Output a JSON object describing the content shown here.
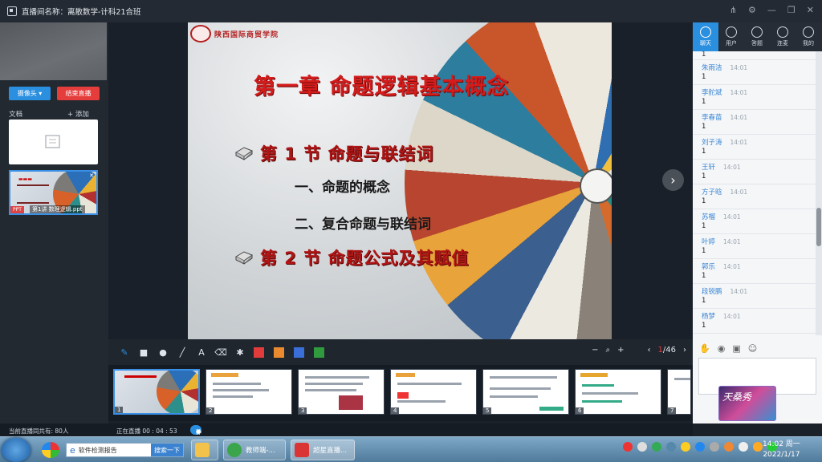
{
  "window": {
    "title": "直播间名称：离散数学-计科21合班"
  },
  "left": {
    "camera_label": "摄像头",
    "end_live_label": "结束直播",
    "docs_label": "文档",
    "add_label": "+ 添加",
    "ppt_badge": "PPT",
    "ppt_name": "第1讲 数理逻辑.ppt"
  },
  "slide": {
    "logo_text": "陕西国际商贸学院",
    "chapter": "第一章  命题逻辑基本概念",
    "section1": "第 1 节  命题与联结词",
    "item1": "一、命题的概念",
    "item2": "二、复合命题与联结词",
    "section2": "第 2 节  命题公式及其赋值"
  },
  "toolbar": {
    "page_current": "1",
    "page_total": "/46",
    "colors": [
      "#e23b3b",
      "#e98a2f",
      "#3b6fd8",
      "#2f9a3e"
    ]
  },
  "thumbnails": [
    "1",
    "2",
    "3",
    "4",
    "5",
    "6",
    "7"
  ],
  "chat": {
    "tabs": [
      "聊天",
      "用户",
      "答题",
      "连麦",
      "我的"
    ],
    "top_partial": "1",
    "messages": [
      {
        "name": "朱雨洁",
        "time": "14:01",
        "text": "1"
      },
      {
        "name": "李舵斌",
        "time": "14:01",
        "text": "1"
      },
      {
        "name": "李春苗",
        "time": "14:01",
        "text": "1"
      },
      {
        "name": "刘子涛",
        "time": "14:01",
        "text": "1"
      },
      {
        "name": "王轩",
        "time": "14:01",
        "text": "1"
      },
      {
        "name": "方子晗",
        "time": "14:01",
        "text": "1"
      },
      {
        "name": "苏榴",
        "time": "14:01",
        "text": "1"
      },
      {
        "name": "叶婷",
        "time": "14:01",
        "text": "1"
      },
      {
        "name": "郭乐",
        "time": "14:01",
        "text": "1"
      },
      {
        "name": "段锐鹏",
        "time": "14:01",
        "text": "1"
      },
      {
        "name": "杨梦",
        "time": "14:01",
        "text": "1"
      }
    ],
    "avatar_text": "天桑秀"
  },
  "status": {
    "viewers": "当前直播同共有: 80人",
    "live_time": "正在直播 00 : 04 : 53",
    "mute": "静音"
  },
  "taskbar": {
    "search_text": "软件检测报告",
    "search_btn": "搜索一下",
    "app1": "教师端-...",
    "app2": "超星直播...",
    "time": "14:02 周一",
    "date": "2022/1/17"
  }
}
